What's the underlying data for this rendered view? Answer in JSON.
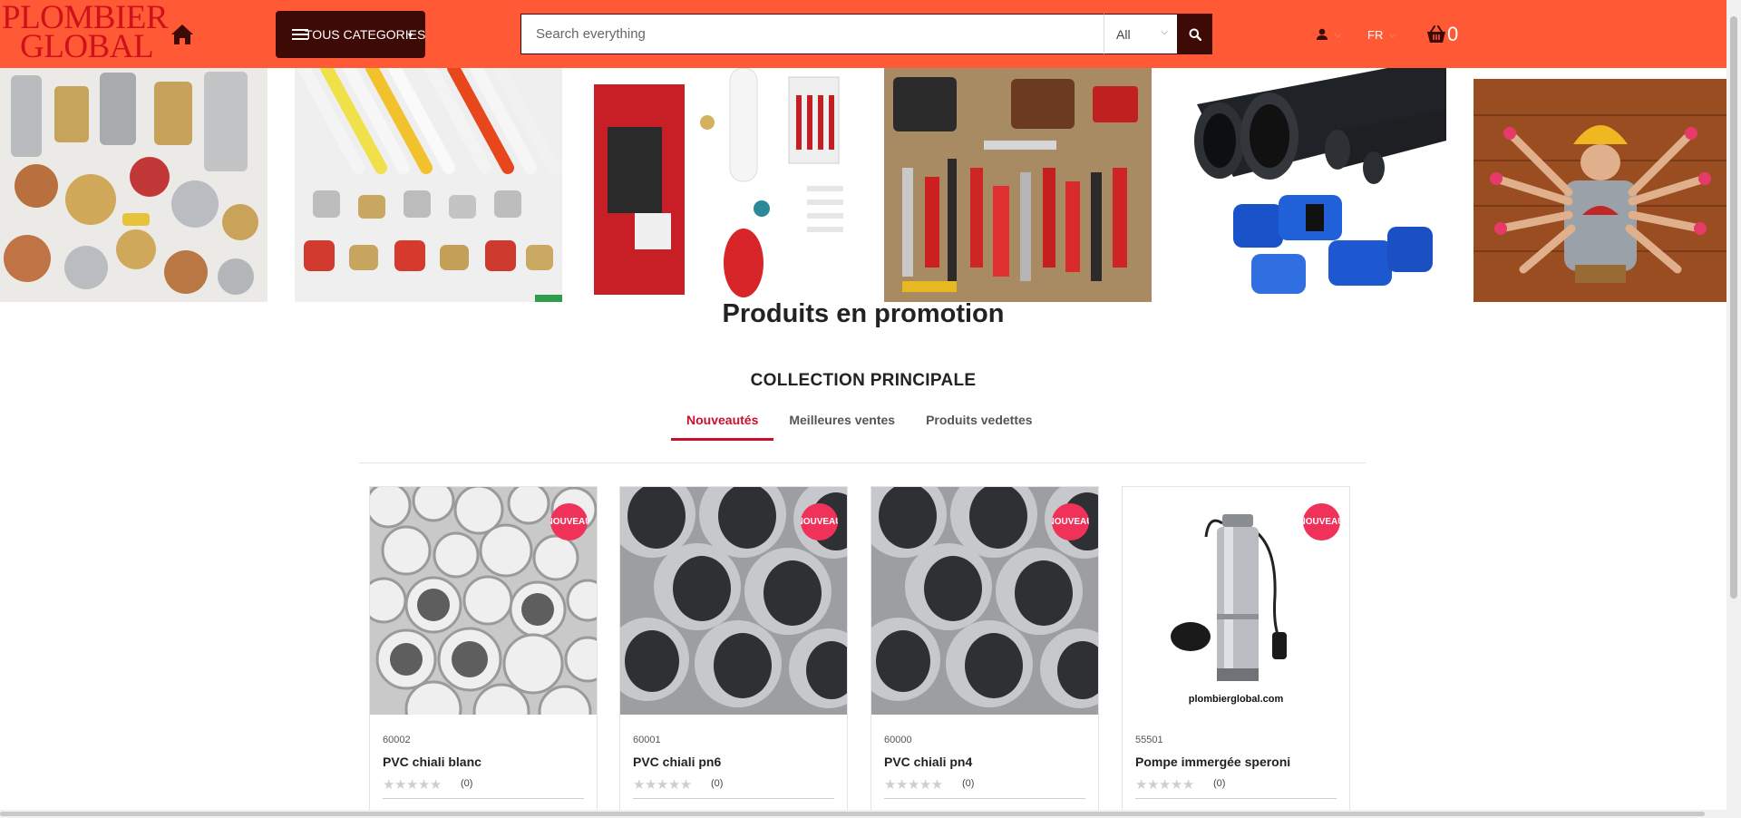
{
  "header": {
    "logo_line1": "PLOMBIER",
    "logo_line2": "GLOBAL",
    "categories_label": "TOUS CATEGORIES",
    "search_placeholder": "Search everything",
    "search_scope": "All",
    "language": "FR",
    "cart_count": "0",
    "icons": [
      "home-icon",
      "menu-icon",
      "search-icon",
      "user-icon",
      "cart-icon"
    ]
  },
  "banner": {
    "tiles": [
      "plumbing-fittings",
      "multilayer-pipes-and-fittings",
      "boiler-and-heating-equipment",
      "tools-set",
      "pe-pipes-and-blue-fittings",
      "multi-armed-worker"
    ]
  },
  "main": {
    "promo_title": "Produits en promotion",
    "collection_title": "COLLECTION PRINCIPALE",
    "tabs": [
      {
        "label": "Nouveautés",
        "active": true
      },
      {
        "label": "Meilleures ventes",
        "active": false
      },
      {
        "label": "Produits vedettes",
        "active": false
      }
    ]
  },
  "products": [
    {
      "ref": "60002",
      "name": "PVC chiali blanc",
      "badge": "NOUVEAU",
      "rating": "★★★★★",
      "reviews": "(0)"
    },
    {
      "ref": "60001",
      "name": "PVC chiali pn6",
      "badge": "NOUVEAU",
      "rating": "★★★★★",
      "reviews": "(0)"
    },
    {
      "ref": "60000",
      "name": "PVC chiali pn4",
      "badge": "NOUVEAU",
      "rating": "★★★★★",
      "reviews": "(0)"
    },
    {
      "ref": "55501",
      "name": "Pompe immergée speroni",
      "badge": "NOUVEAU",
      "rating": "★★★★★",
      "reviews": "(0)",
      "image_caption": "plombierglobal.com"
    }
  ],
  "colors": {
    "header_bg": "#ff5a35",
    "dark_accent": "#3e0a05",
    "logo_red": "#d0101a",
    "active_tab": "#c8102e",
    "badge": "#f0325a"
  }
}
